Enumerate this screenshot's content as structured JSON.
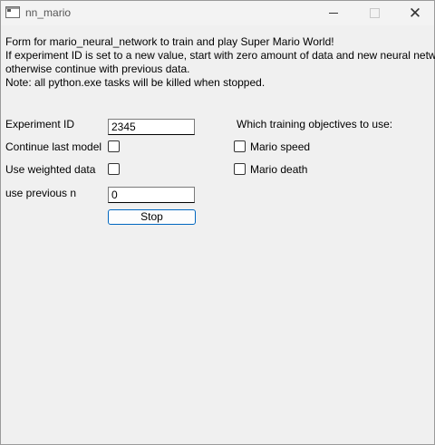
{
  "window": {
    "title": "nn_mario",
    "icon": "app-window-icon"
  },
  "description": {
    "lines": [
      "Form for mario_neural_network to train and play Super Mario World!",
      "If experiment ID is set to a new value, start with zero amount of data and new neural network,",
      "otherwise continue with previous data.",
      "Note: all python.exe tasks will be killed when stopped."
    ]
  },
  "form": {
    "experiment_id_label": "Experiment ID",
    "experiment_id_value": "2345",
    "continue_label": "Continue last model",
    "continue_checked": false,
    "weighted_label": "Use weighted data",
    "weighted_checked": false,
    "previous_n_label": "use previous n",
    "previous_n_value": "0",
    "stop_button": "Stop"
  },
  "objectives": {
    "heading": "Which training objectives to use:",
    "speed_label": "Mario speed",
    "speed_checked": false,
    "death_label": "Mario death",
    "death_checked": false
  }
}
